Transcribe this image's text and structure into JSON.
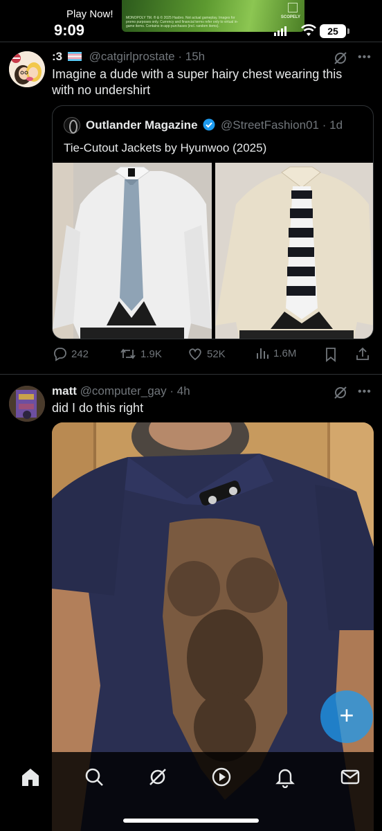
{
  "status_bar": {
    "back_app_label": "Play Now!",
    "time": "9:09",
    "battery": "25",
    "ad": {
      "fine_print": "MONOPOLY TM. ® & © 2025 Hasbro. Not actual gameplay. Images for promo purposes only. Currency and financial terms refer only to virtual in-game items. Contains in-app purchases (incl. random items).",
      "brand": "SCOPELY"
    }
  },
  "posts": [
    {
      "display_name": ":3",
      "handle": "@catgirlprostate",
      "age": "· 15h",
      "text_lines": [
        "Imagine a dude with a super hairy chest wearing this",
        "with no undershirt"
      ],
      "quote": {
        "name": "Outlander Magazine",
        "handle": "@StreetFashion01",
        "age": "· 1d",
        "text": "Tie-Cutout Jackets by Hyunwoo (2025)"
      },
      "actions": {
        "replies": "242",
        "reposts": "1.9K",
        "likes": "52K",
        "views": "1.6M"
      }
    },
    {
      "display_name": "matt",
      "handle": "@computer_gay",
      "age": "· 4h",
      "text_lines": [
        "did I do this right"
      ]
    }
  ],
  "fab": {
    "label": "+"
  },
  "tabs": [
    "home-icon",
    "search-icon",
    "grok-icon",
    "video-icon",
    "notifications-icon",
    "messages-icon"
  ],
  "colors": {
    "accent": "#1d9bf0",
    "verified": "#1d9bf0",
    "muted_text": "#71767b",
    "shirt_navy": "#2a2f52"
  }
}
